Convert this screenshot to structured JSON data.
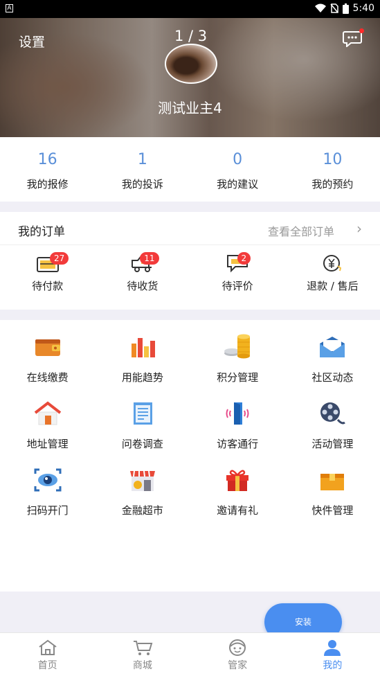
{
  "statusbar": {
    "time": "5:40",
    "app_icon": "A"
  },
  "header": {
    "settings_label": "设置",
    "pager": "1 / 3",
    "username": "测试业主4",
    "message_icon": "chat-bubble-icon"
  },
  "stats": [
    {
      "value": "16",
      "label": "我的报修"
    },
    {
      "value": "1",
      "label": "我的投诉"
    },
    {
      "value": "0",
      "label": "我的建议"
    },
    {
      "value": "10",
      "label": "我的预约"
    }
  ],
  "orders": {
    "title": "我的订单",
    "view_all": "查看全部订单",
    "items": [
      {
        "label": "待付款",
        "badge": "27",
        "icon": "wallet-card-icon"
      },
      {
        "label": "待收货",
        "badge": "11",
        "icon": "truck-icon"
      },
      {
        "label": "待评价",
        "badge": "2",
        "icon": "comment-icon"
      },
      {
        "label": "退款 / 售后",
        "badge": "",
        "icon": "refund-yen-icon"
      }
    ]
  },
  "services": [
    {
      "label": "在线缴费",
      "icon": "wallet-icon"
    },
    {
      "label": "用能趋势",
      "icon": "bar-chart-icon"
    },
    {
      "label": "积分管理",
      "icon": "coins-icon"
    },
    {
      "label": "社区动态",
      "icon": "envelope-icon"
    },
    {
      "label": "地址管理",
      "icon": "house-icon"
    },
    {
      "label": "问卷调查",
      "icon": "document-icon"
    },
    {
      "label": "访客通行",
      "icon": "door-icon"
    },
    {
      "label": "活动管理",
      "icon": "film-reel-icon"
    },
    {
      "label": "扫码开门",
      "icon": "scan-eye-icon"
    },
    {
      "label": "金融超市",
      "icon": "store-icon"
    },
    {
      "label": "邀请有礼",
      "icon": "gift-icon"
    },
    {
      "label": "快件管理",
      "icon": "box-icon"
    }
  ],
  "install_label": "安装",
  "tabs": [
    {
      "label": "首页",
      "icon": "home-icon",
      "active": false
    },
    {
      "label": "商城",
      "icon": "cart-icon",
      "active": false
    },
    {
      "label": "管家",
      "icon": "butler-face-icon",
      "active": false
    },
    {
      "label": "我的",
      "icon": "person-icon",
      "active": true
    }
  ],
  "colors": {
    "accent": "#4a8ef0",
    "stat_number": "#5a8fd8",
    "badge": "#f23a3a"
  }
}
